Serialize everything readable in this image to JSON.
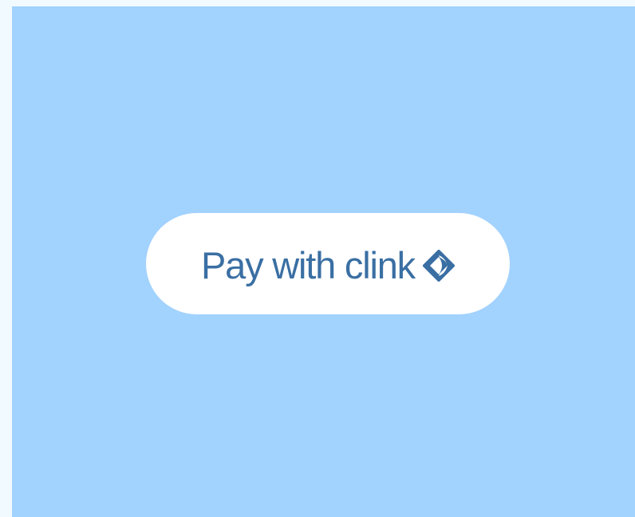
{
  "colors": {
    "page_background": "#f1fbff",
    "canvas_background": "#a2d2fe",
    "button_background": "#ffffff",
    "button_text": "#3a6fa3"
  },
  "pay_button": {
    "label": "Pay with clink",
    "icon": "clink-logo-icon"
  }
}
